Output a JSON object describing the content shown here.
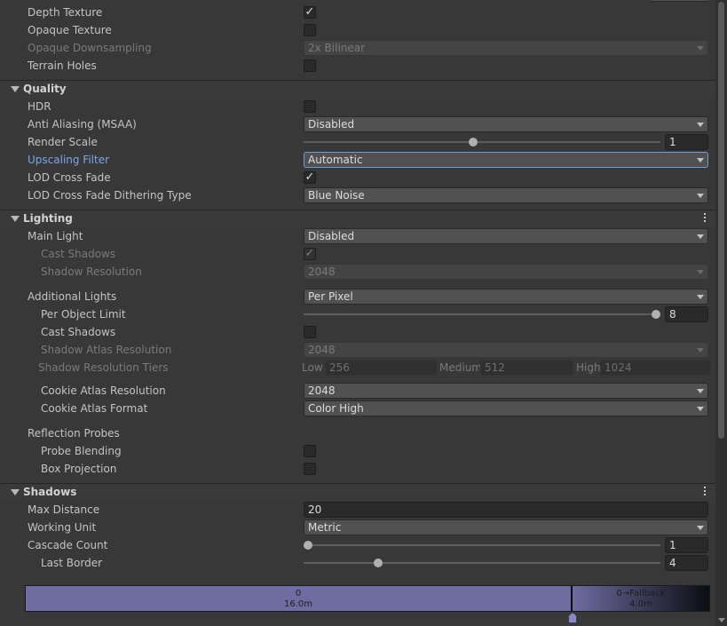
{
  "rendering": {
    "depth_texture": {
      "label": "Depth Texture",
      "checked": true
    },
    "opaque_texture": {
      "label": "Opaque Texture",
      "checked": false
    },
    "opaque_downsampling": {
      "label": "Opaque Downsampling",
      "value": "2x Bilinear"
    },
    "terrain_holes": {
      "label": "Terrain Holes",
      "checked": false
    }
  },
  "quality": {
    "title": "Quality",
    "hdr": {
      "label": "HDR",
      "checked": false
    },
    "anti_aliasing": {
      "label": "Anti Aliasing (MSAA)",
      "value": "Disabled"
    },
    "render_scale": {
      "label": "Render Scale",
      "value": "1",
      "slider_fraction": 0.47
    },
    "upscaling_filter": {
      "label": "Upscaling Filter",
      "value": "Automatic"
    },
    "lod_cross_fade": {
      "label": "LOD Cross Fade",
      "checked": true
    },
    "lod_dithering": {
      "label": "LOD Cross Fade Dithering Type",
      "value": "Blue Noise"
    }
  },
  "lighting": {
    "title": "Lighting",
    "main_light": {
      "label": "Main Light",
      "value": "Disabled"
    },
    "cast_shadows": {
      "label": "Cast Shadows",
      "checked": true
    },
    "shadow_resolution": {
      "label": "Shadow Resolution",
      "value": "2048"
    },
    "additional_lights": {
      "label": "Additional Lights",
      "value": "Per Pixel"
    },
    "per_object_limit": {
      "label": "Per Object Limit",
      "value": "8",
      "slider_fraction": 1.0
    },
    "add_cast_shadows": {
      "label": "Cast Shadows",
      "checked": false
    },
    "shadow_atlas_resolution": {
      "label": "Shadow Atlas Resolution",
      "value": "2048"
    },
    "shadow_resolution_tiers": {
      "label": "Shadow Resolution Tiers",
      "low_label": "Low",
      "low_value": "256",
      "medium_label": "Medium",
      "medium_value": "512",
      "high_label": "High",
      "high_value": "1024"
    },
    "cookie_atlas_resolution": {
      "label": "Cookie Atlas Resolution",
      "value": "2048"
    },
    "cookie_atlas_format": {
      "label": "Cookie Atlas Format",
      "value": "Color High"
    },
    "reflection_probes": {
      "label": "Reflection Probes"
    },
    "probe_blending": {
      "label": "Probe Blending",
      "checked": false
    },
    "box_projection": {
      "label": "Box Projection",
      "checked": false
    }
  },
  "shadows": {
    "title": "Shadows",
    "max_distance": {
      "label": "Max Distance",
      "value": "20"
    },
    "working_unit": {
      "label": "Working Unit",
      "value": "Metric"
    },
    "cascade_count": {
      "label": "Cascade Count",
      "value": "1",
      "slider_fraction": 0.0
    },
    "last_border": {
      "label": "Last Border",
      "value": "4",
      "slider_fraction": 0.21
    },
    "cascade_bar": {
      "seg0_index": "0",
      "seg0_dist": "16.0m",
      "fallback_label": "0→Fallback",
      "fallback_dist": "4.0m"
    }
  },
  "icons": {
    "check": "✓"
  },
  "colors": {
    "background": "#383838",
    "highlight_label": "#7ba8e8",
    "cascade_color": "#6e6ca0"
  }
}
